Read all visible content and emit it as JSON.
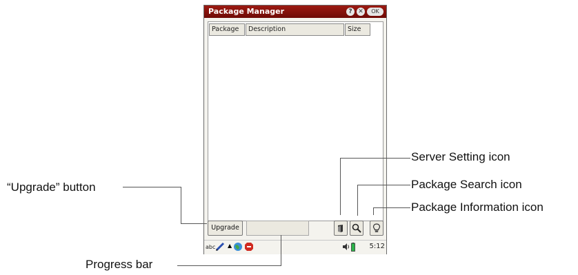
{
  "window": {
    "title": "Package Manager",
    "help_glyph": "?",
    "close_glyph": "✕",
    "ok_label": "OK"
  },
  "table": {
    "columns": [
      "Package",
      "Description",
      "Size"
    ]
  },
  "footer": {
    "upgrade_label": "Upgrade",
    "progress_fraction": 0
  },
  "taskbar": {
    "input_label": "abc",
    "clock": "5:12"
  },
  "annotations": {
    "server_setting": "Server Setting icon",
    "package_search": "Package Search icon",
    "package_information": "Package Information icon",
    "upgrade": "“Upgrade” button",
    "progress": "Progress bar"
  },
  "icons": [
    "server-setting-icon",
    "package-search-icon",
    "package-information-icon",
    "help-icon",
    "close-icon",
    "volume-icon",
    "battery-icon",
    "pencil-icon",
    "globe-icon",
    "stop-icon"
  ],
  "colors": {
    "titlebar": "#8a1610",
    "background": "#f4f3ee",
    "button": "#ebe9e0"
  }
}
